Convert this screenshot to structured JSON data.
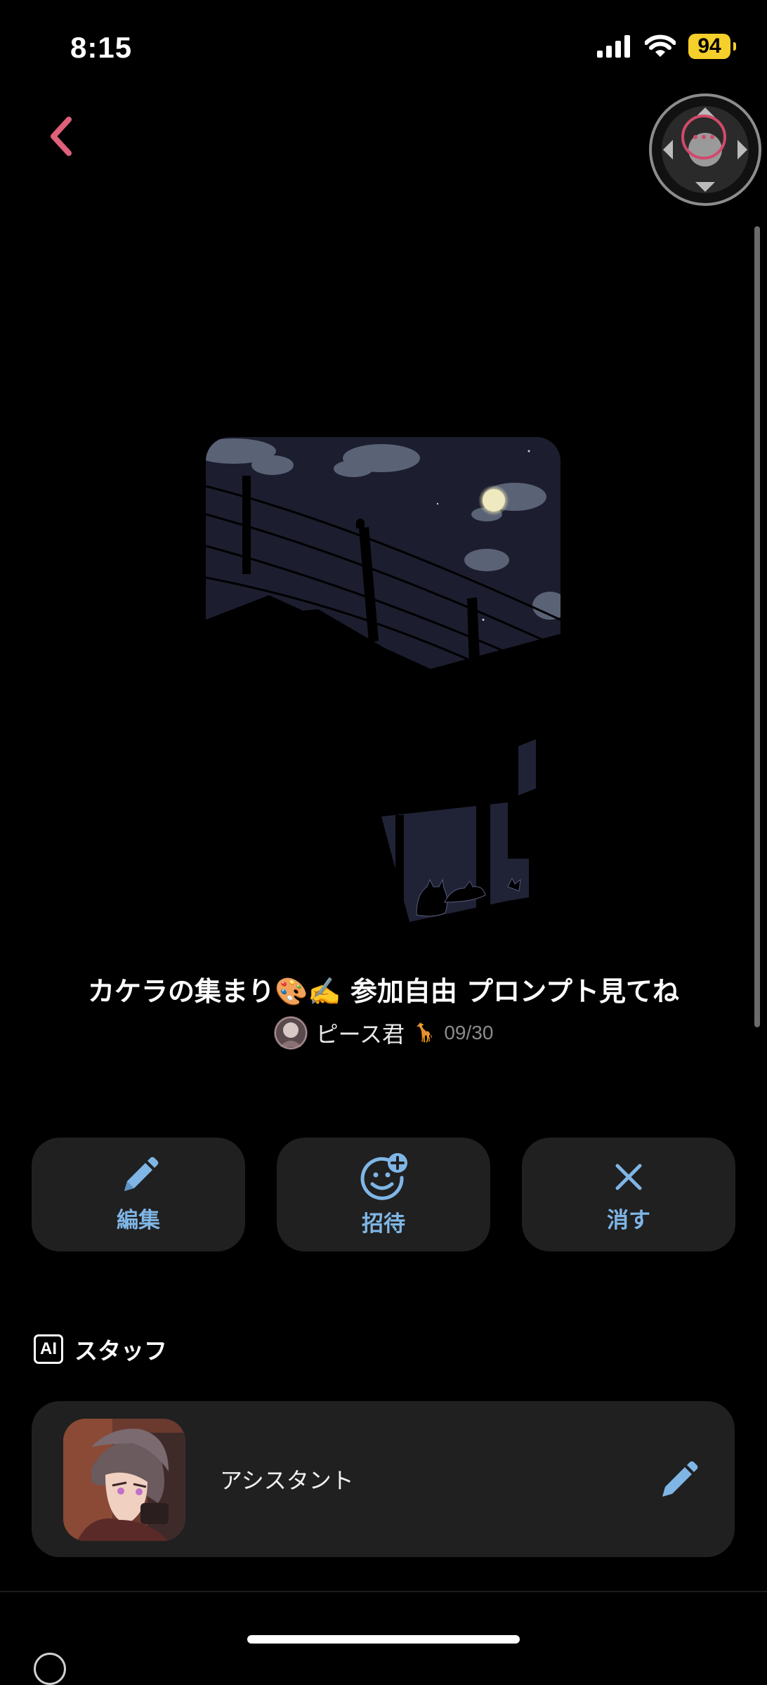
{
  "status_bar": {
    "time": "8:15",
    "battery": "94"
  },
  "room": {
    "title": "カケラの集まり🎨✍️ 参加自由 プロンプト見てね",
    "author": "ピース君",
    "author_emoji": "🦒",
    "date": "09/30"
  },
  "actions": [
    {
      "label": "編集",
      "icon": "pencil-icon"
    },
    {
      "label": "招待",
      "icon": "add-smile-icon"
    },
    {
      "label": "消す",
      "icon": "close-icon"
    }
  ],
  "staff_section": {
    "badge": "AI",
    "title": "スタッフ"
  },
  "staff": [
    {
      "name": "アシスタント"
    }
  ],
  "colors": {
    "accent_blue": "#7fb6e6",
    "back_pink": "#e0607a",
    "card_bg": "#202020",
    "battery_yellow": "#f5cf2a"
  }
}
